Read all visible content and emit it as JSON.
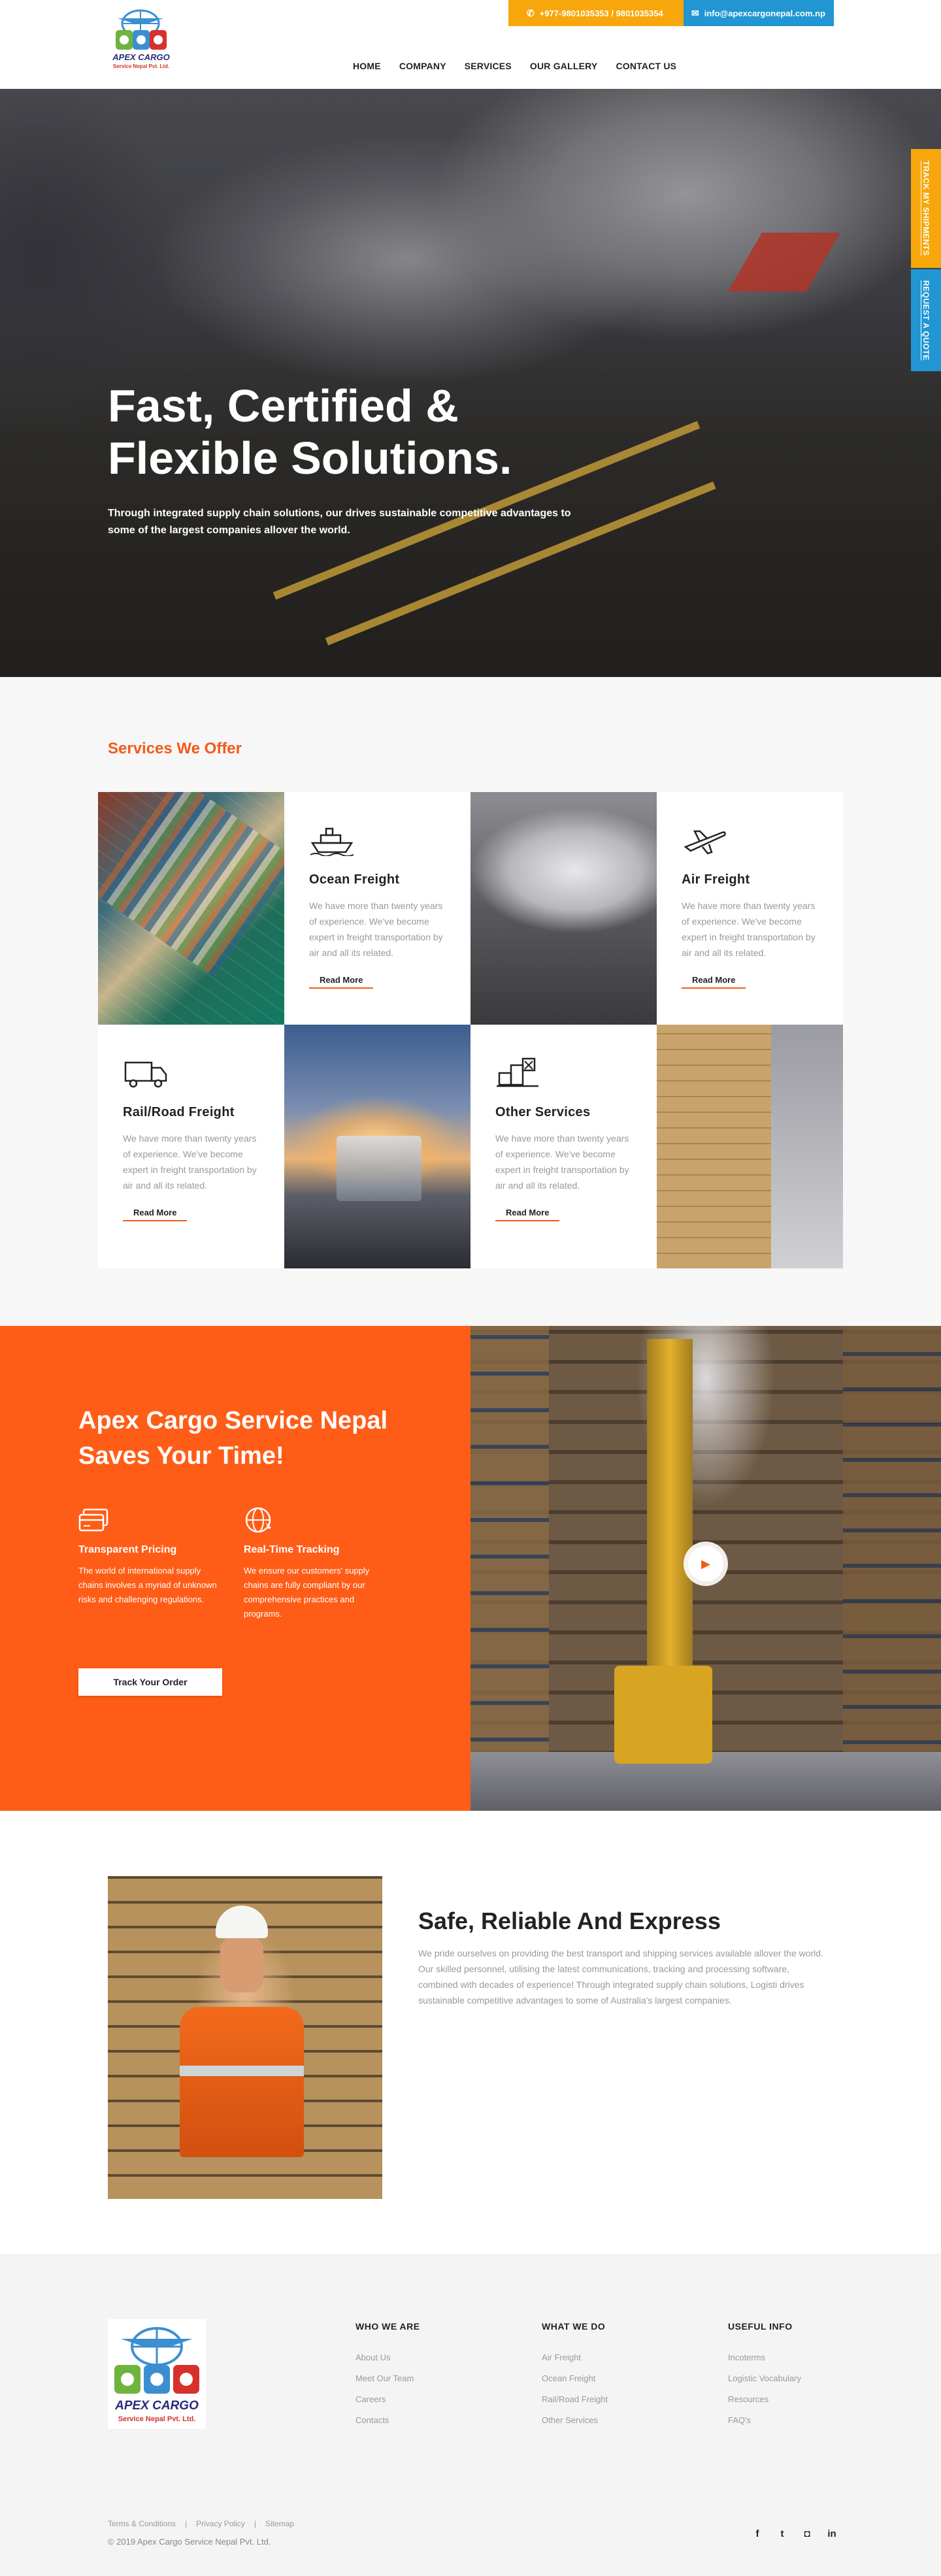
{
  "header": {
    "logo_text": "APEX CARGO",
    "logo_subtext": "Service Nepal Pvt. Ltd.",
    "phone": "+977-9801035353 / 9801035354",
    "email": "info@apexcargonepal.com.np",
    "nav": [
      "HOME",
      "COMPANY",
      "SERVICES",
      "OUR GALLERY",
      "CONTACT US"
    ]
  },
  "hero": {
    "title": "Fast, Certified & Flexible Solutions.",
    "subtitle": "Through integrated supply chain solutions, our drives sustainable competitive advantages to some of the largest companies allover the world.",
    "side_tabs": [
      "TRACK MY SHIPMENTS",
      "REQUEST A QUOTE"
    ]
  },
  "services": {
    "heading": "Services We Offer",
    "items": [
      {
        "title": "Ocean Freight",
        "icon": "ship-icon",
        "text": "We have more than twenty years of experience. We've become expert in freight transportation by air and all its related.",
        "cta": "Read More"
      },
      {
        "title": "Air Freight",
        "icon": "airplane-icon",
        "text": "We have more than twenty years of experience. We've become expert in freight transportation by air and all its related.",
        "cta": "Read More"
      },
      {
        "title": "Rail/Road Freight",
        "icon": "truck-icon",
        "text": "We have more than twenty years of experience. We've become expert in freight transportation by air and all its related.",
        "cta": "Read More"
      },
      {
        "title": "Other Services",
        "icon": "boxes-icon",
        "text": "We have more than twenty years of experience. We've become expert in freight transportation by air and all its related.",
        "cta": "Read More"
      }
    ]
  },
  "feature": {
    "title": "Apex Cargo Service Nepal Saves Your Time!",
    "items": [
      {
        "title": "Transparent Pricing",
        "icon": "credit-card-icon",
        "text": "The world of international supply chains involves a myriad of unknown risks and challenging regulations."
      },
      {
        "title": "Real-Time Tracking",
        "icon": "globe-icon",
        "text": "We ensure our customers' supply chains are fully compliant by our comprehensive practices and programs."
      }
    ],
    "button": "Track Your Order"
  },
  "safe": {
    "title": "Safe, Reliable And Express",
    "text": "We pride ourselves on providing the best transport and shipping services available allover the world. Our skilled personnel, utilising the latest communications, tracking and processing software, combined with decades of experience! Through integrated supply chain solutions, Logisti drives sustainable competitive advantages to some of Australia's largest companies."
  },
  "footer": {
    "columns": [
      {
        "title": "WHO WE ARE",
        "links": [
          "About Us",
          "Meet Our Team",
          "Careers",
          "Contacts"
        ]
      },
      {
        "title": "WHAT WE DO",
        "links": [
          "Air Freight",
          "Ocean Freight",
          "Rail/Road Freight",
          "Other Services"
        ]
      },
      {
        "title": "USEFUL INFO",
        "links": [
          "Incoterms",
          "Logistic Vocabulary",
          "Resources",
          "FAQ's"
        ]
      }
    ],
    "bottom_links": [
      "Terms & Conditions",
      "Privacy Policy",
      "Sitemap"
    ],
    "copyright": "© 2019 Apex Cargo Service Nepal Pvt. Ltd.",
    "social": [
      {
        "icon": "facebook-icon",
        "glyph": "f"
      },
      {
        "icon": "twitter-icon",
        "glyph": "t"
      },
      {
        "icon": "instagram-icon",
        "glyph": "◘"
      },
      {
        "icon": "linkedin-icon",
        "glyph": "in"
      }
    ]
  },
  "colors": {
    "accent_orange": "#ff5d17",
    "contact_yellow": "#f7a70b",
    "contact_blue": "#2196d3",
    "heading_orange": "#f25b17"
  }
}
